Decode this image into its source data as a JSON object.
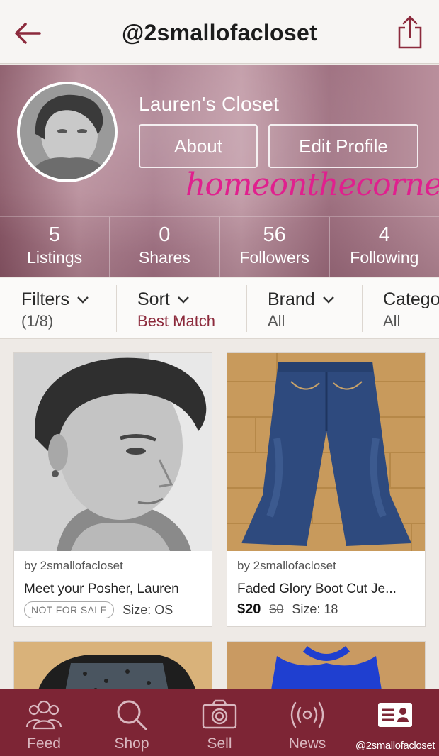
{
  "header": {
    "title": "@2smallofacloset",
    "back_icon": "back-arrow-icon",
    "share_icon": "share-icon",
    "accent_color": "#8c2a3c"
  },
  "profile": {
    "closet_name": "Lauren's Closet",
    "about_label": "About",
    "edit_label": "Edit Profile",
    "watermark": "homeonthecorner",
    "stats": [
      {
        "value": "5",
        "label": "Listings"
      },
      {
        "value": "0",
        "label": "Shares"
      },
      {
        "value": "56",
        "label": "Followers"
      },
      {
        "value": "4",
        "label": "Following"
      }
    ]
  },
  "filters": [
    {
      "title": "Filters",
      "sub": "(1/8)"
    },
    {
      "title": "Sort",
      "sub": "Best Match"
    },
    {
      "title": "Brand",
      "sub": "All"
    },
    {
      "title": "Catego",
      "sub": "All"
    }
  ],
  "listings": [
    {
      "seller": "by 2smallofacloset",
      "title": "Meet your Posher, Lauren",
      "badge": "NOT FOR SALE",
      "size": "Size: OS"
    },
    {
      "seller": "by 2smallofacloset",
      "title": "Faded Glory Boot Cut Je...",
      "price": "$20",
      "original_price": "$0",
      "size": "Size: 18"
    }
  ],
  "tabs": [
    {
      "label": "Feed",
      "icon": "people-icon"
    },
    {
      "label": "Shop",
      "icon": "search-icon"
    },
    {
      "label": "Sell",
      "icon": "camera-icon"
    },
    {
      "label": "News",
      "icon": "broadcast-icon"
    },
    {
      "label": "@2smallofacloset",
      "icon": "profile-card-icon"
    }
  ],
  "colors": {
    "tabbar": "#7d2535",
    "watermark": "#e0208e"
  }
}
